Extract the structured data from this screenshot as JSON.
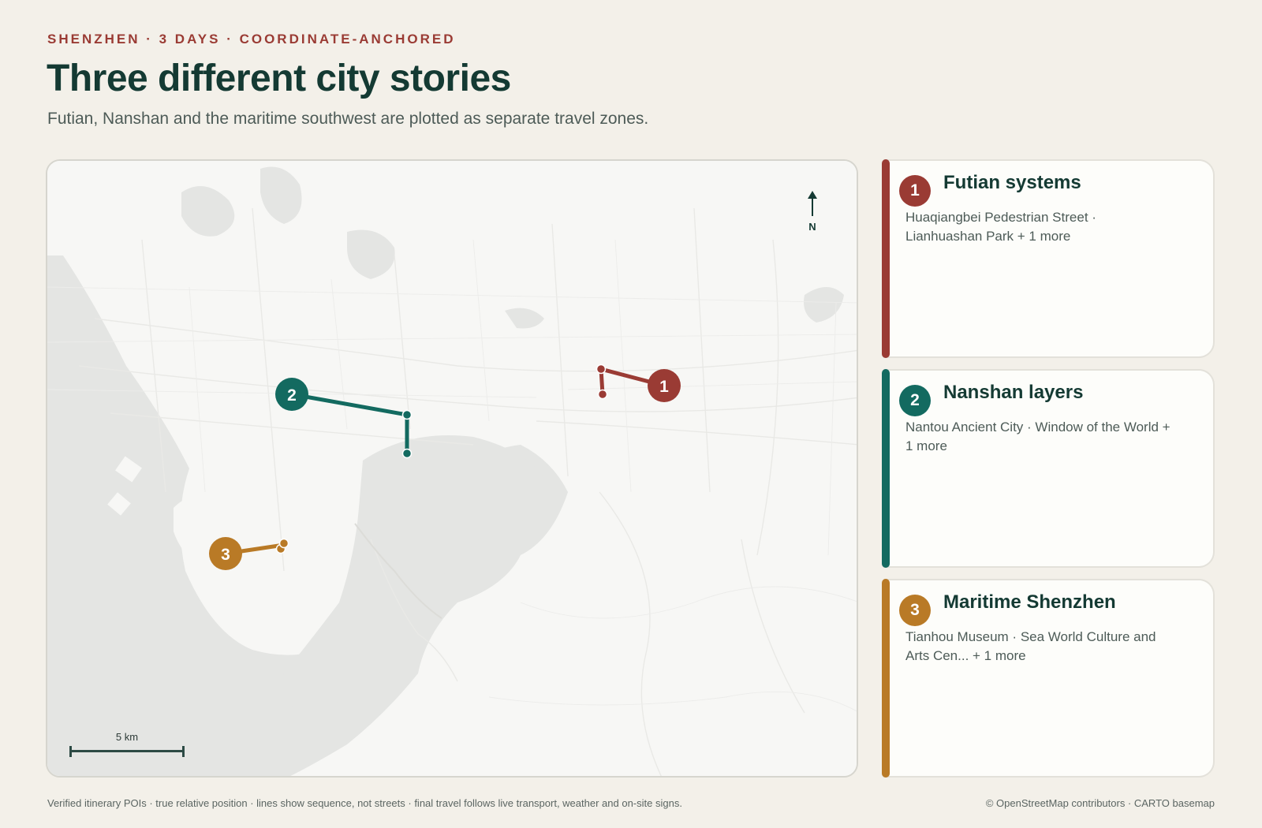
{
  "header": {
    "eyebrow": "SHENZHEN · 3 DAYS · COORDINATE-ANCHORED",
    "title": "Three different city stories",
    "subtitle": "Futian, Nanshan and the maritime southwest are plotted as separate travel zones."
  },
  "map": {
    "north_label": "N",
    "scale_label": "5 km",
    "zones": [
      {
        "number": "1",
        "color": "#9a3b34"
      },
      {
        "number": "2",
        "color": "#136a60"
      },
      {
        "number": "3",
        "color": "#b97a26"
      }
    ]
  },
  "cards": [
    {
      "number": "1",
      "title": "Futian systems",
      "description": "Huaqiangbei Pedestrian Street · Lianhuashan Park + 1 more",
      "color": "#9a3b34"
    },
    {
      "number": "2",
      "title": "Nanshan layers",
      "description": "Nantou Ancient City · Window of the World + 1 more",
      "color": "#136a60"
    },
    {
      "number": "3",
      "title": "Maritime Shenzhen",
      "description": "Tianhou Museum · Sea World Culture and Arts Cen... + 1 more",
      "color": "#b97a26"
    }
  ],
  "footer": {
    "note": "Verified itinerary POIs · true relative position · lines show sequence, not streets · final travel follows live transport, weather and on-site signs.",
    "attribution": "© OpenStreetMap contributors · CARTO basemap"
  }
}
